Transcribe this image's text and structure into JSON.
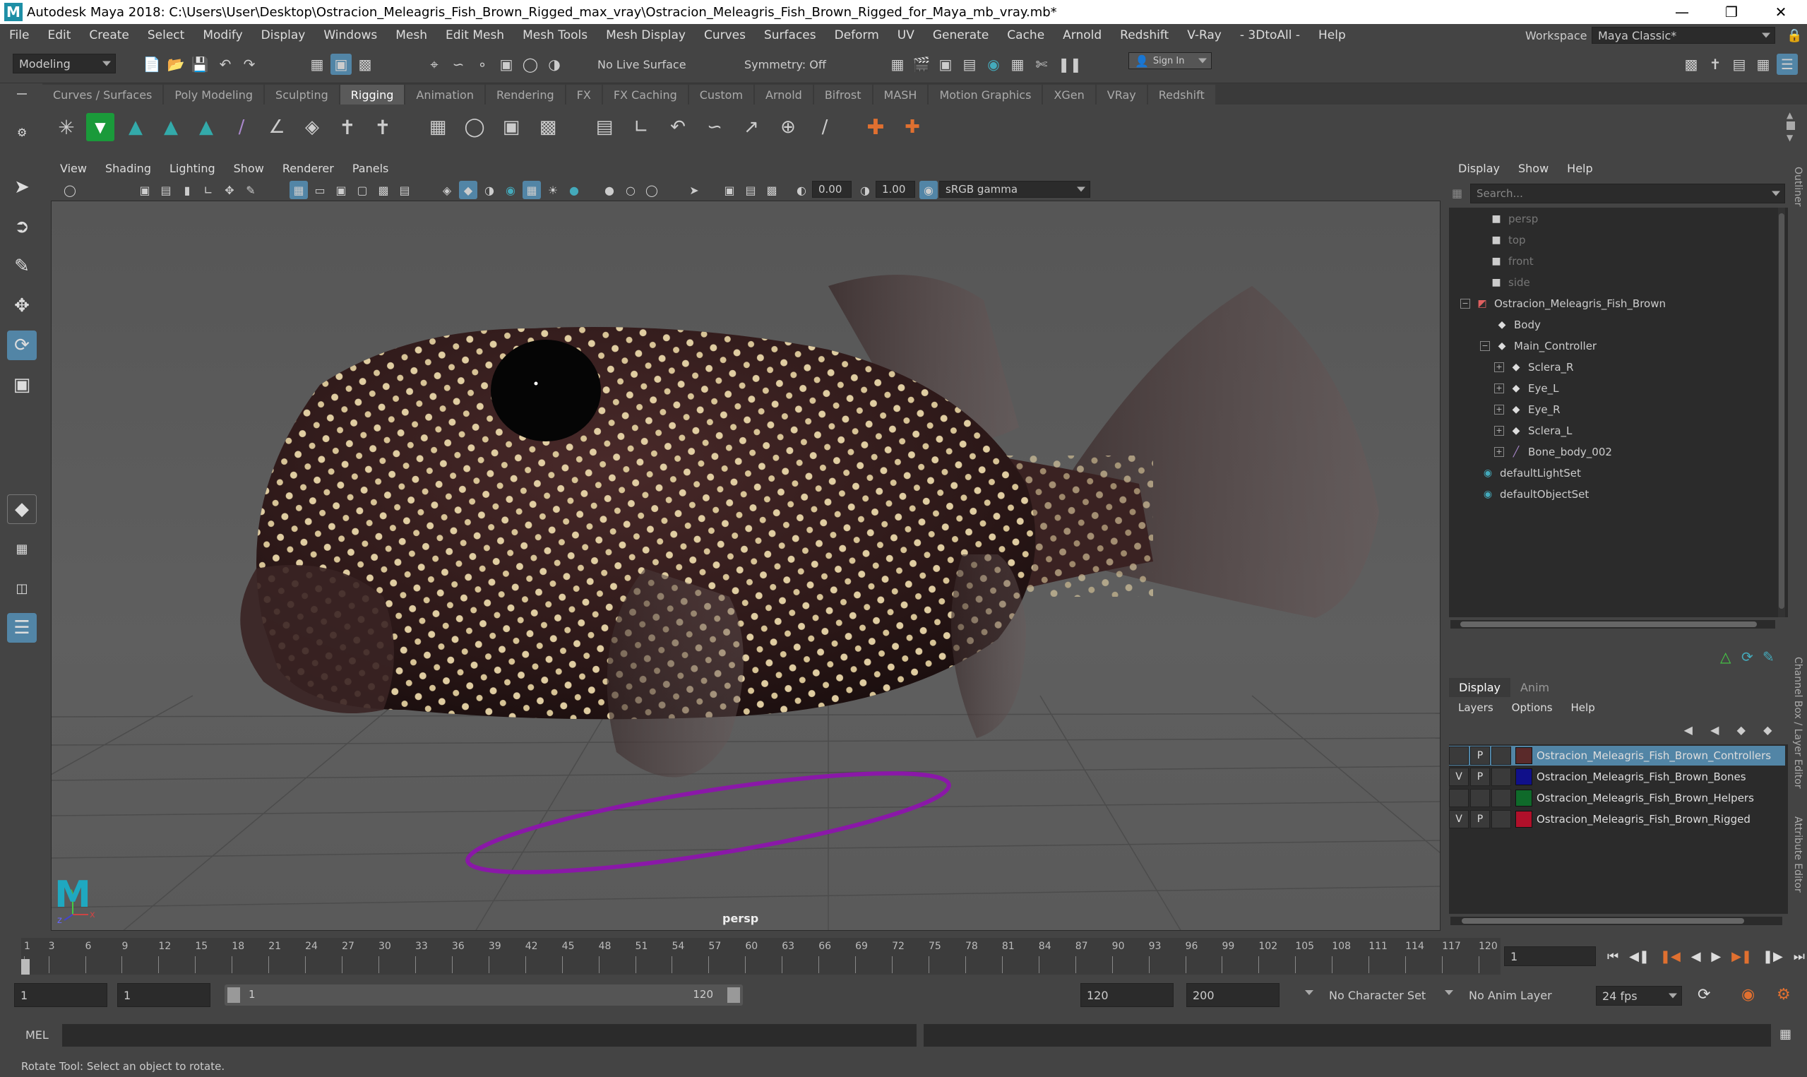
{
  "window": {
    "title": "Autodesk Maya 2018: C:\\Users\\User\\Desktop\\Ostracion_Meleagris_Fish_Brown_Rigged_max_vray\\Ostracion_Meleagris_Fish_Brown_Rigged_for_Maya_mb_vray.mb*",
    "logo": "M",
    "minimize": "—",
    "maximize": "❐",
    "close": "✕"
  },
  "menubar": {
    "items": [
      "File",
      "Edit",
      "Create",
      "Select",
      "Modify",
      "Display",
      "Windows",
      "Mesh",
      "Edit Mesh",
      "Mesh Tools",
      "Mesh Display",
      "Curves",
      "Surfaces",
      "Deform",
      "UV",
      "Generate",
      "Cache",
      "Arnold",
      "Redshift",
      "V-Ray",
      "- 3DtoAll -",
      "Help"
    ],
    "workspace_label": "Workspace :",
    "workspace_value": "Maya Classic*"
  },
  "toolbar": {
    "mode": "Modeling",
    "live_surface": "No Live Surface",
    "symmetry": "Symmetry: Off",
    "sign_in": "Sign In"
  },
  "shelf": {
    "tabs": [
      "Curves / Surfaces",
      "Poly Modeling",
      "Sculpting",
      "Rigging",
      "Animation",
      "Rendering",
      "FX",
      "FX Caching",
      "Custom",
      "Arnold",
      "Bifrost",
      "MASH",
      "Motion Graphics",
      "XGen",
      "VRay",
      "Redshift"
    ],
    "active_tab": "Rigging"
  },
  "viewport": {
    "menu": [
      "View",
      "Shading",
      "Lighting",
      "Show",
      "Renderer",
      "Panels"
    ],
    "exposure": "0.00",
    "gamma": "1.00",
    "color_space": "sRGB gamma",
    "camera_label": "persp"
  },
  "outliner": {
    "menu": [
      "Display",
      "Show",
      "Help"
    ],
    "search_placeholder": "Search...",
    "items": [
      {
        "label": "persp",
        "icon": "camera-icon",
        "dim": true
      },
      {
        "label": "top",
        "icon": "camera-icon",
        "dim": true
      },
      {
        "label": "front",
        "icon": "camera-icon",
        "dim": true
      },
      {
        "label": "side",
        "icon": "camera-icon",
        "dim": true
      },
      {
        "label": "Ostracion_Meleagris_Fish_Brown",
        "icon": "group-icon",
        "dim": false
      },
      {
        "label": "Body",
        "icon": "mesh-icon",
        "dim": false
      },
      {
        "label": "Main_Controller",
        "icon": "mesh-icon",
        "dim": false
      },
      {
        "label": "Sclera_R",
        "icon": "mesh-icon",
        "dim": false
      },
      {
        "label": "Eye_L",
        "icon": "mesh-icon",
        "dim": false
      },
      {
        "label": "Eye_R",
        "icon": "mesh-icon",
        "dim": false
      },
      {
        "label": "Sclera_L",
        "icon": "mesh-icon",
        "dim": false
      },
      {
        "label": "Bone_body_002",
        "icon": "joint-icon",
        "dim": false
      },
      {
        "label": "defaultLightSet",
        "icon": "set-icon",
        "dim": false
      },
      {
        "label": "defaultObjectSet",
        "icon": "set-icon",
        "dim": false
      }
    ]
  },
  "layer_editor": {
    "tabs": [
      "Display",
      "Anim"
    ],
    "menu": [
      "Layers",
      "Options",
      "Help"
    ],
    "layers": [
      {
        "v": "",
        "p": "P",
        "name": "Ostracion_Meleagris_Fish_Brown_Controllers",
        "color": "#5a2a2a",
        "selected": true
      },
      {
        "v": "V",
        "p": "P",
        "name": "Ostracion_Meleagris_Fish_Brown_Bones",
        "color": "#10108a",
        "selected": false
      },
      {
        "v": "",
        "p": "",
        "name": "Ostracion_Meleagris_Fish_Brown_Helpers",
        "color": "#0f6a2a",
        "selected": false
      },
      {
        "v": "V",
        "p": "P",
        "name": "Ostracion_Meleagris_Fish_Brown_Rigged",
        "color": "#b0102a",
        "selected": false
      }
    ]
  },
  "side_tabs": {
    "outliner": "Outliner",
    "channel_box": "Channel Box / Layer Editor",
    "attribute_editor": "Attribute Editor"
  },
  "timeline": {
    "ticks": [
      "1",
      "3",
      "6",
      "9",
      "12",
      "15",
      "18",
      "21",
      "24",
      "27",
      "30",
      "33",
      "36",
      "39",
      "42",
      "45",
      "48",
      "51",
      "54",
      "57",
      "60",
      "63",
      "66",
      "69",
      "72",
      "75",
      "78",
      "81",
      "84",
      "87",
      "90",
      "93",
      "96",
      "99",
      "102",
      "105",
      "108",
      "111",
      "114",
      "117",
      "120"
    ],
    "current_frame": "1"
  },
  "range": {
    "start": "1",
    "playback_start": "1",
    "slider_start": "1",
    "slider_end": "120",
    "playback_end": "120",
    "end": "200",
    "character_set": "No Character Set",
    "anim_layer": "No Anim Layer",
    "fps": "24 fps"
  },
  "command": {
    "label": "MEL"
  },
  "status": {
    "text": "Rotate Tool: Select an object to rotate."
  }
}
